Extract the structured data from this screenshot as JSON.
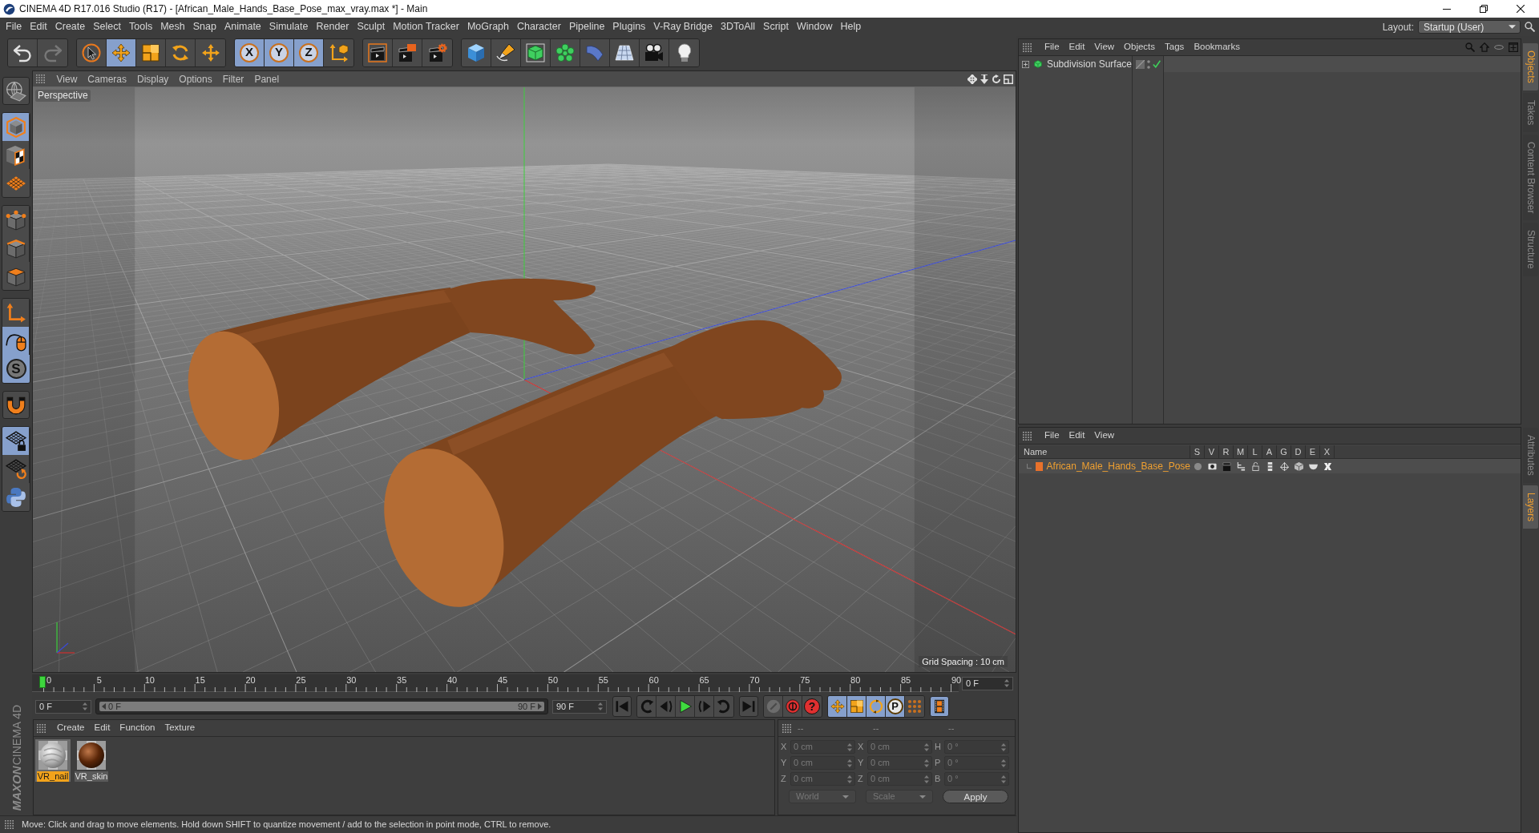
{
  "window": {
    "title": "CINEMA 4D R17.016 Studio (R17) - [African_Male_Hands_Base_Pose_max_vray.max *] - Main"
  },
  "menu_bar": {
    "items": [
      "File",
      "Edit",
      "Create",
      "Select",
      "Tools",
      "Mesh",
      "Snap",
      "Animate",
      "Simulate",
      "Render",
      "Sculpt",
      "Motion Tracker",
      "MoGraph",
      "Character",
      "Pipeline",
      "Plugins",
      "V-Ray Bridge",
      "3DToAll",
      "Script",
      "Window",
      "Help"
    ],
    "layout_label": "Layout:",
    "layout_value": "Startup (User)"
  },
  "toolbar": {
    "groups": [
      {
        "items": [
          {
            "kind": "undo",
            "selected": false,
            "disabled": false
          },
          {
            "kind": "redo",
            "selected": false,
            "disabled": true
          }
        ]
      },
      {
        "items": [
          {
            "kind": "live-selection",
            "selected": false,
            "disabled": false
          },
          {
            "kind": "move",
            "selected": true,
            "disabled": false
          },
          {
            "kind": "scale",
            "selected": false,
            "disabled": false
          },
          {
            "kind": "rotate",
            "selected": false,
            "disabled": false
          },
          {
            "kind": "cross-move",
            "selected": false,
            "disabled": false
          }
        ]
      },
      {
        "items": [
          {
            "kind": "axis",
            "label": "X",
            "selected": true,
            "disabled": false
          },
          {
            "kind": "axis",
            "label": "Y",
            "selected": true,
            "disabled": false
          },
          {
            "kind": "axis",
            "label": "Z",
            "selected": true,
            "disabled": false
          },
          {
            "kind": "coordinate-system",
            "selected": false,
            "disabled": false
          }
        ]
      },
      {
        "items": [
          {
            "kind": "render-view",
            "selected": false,
            "disabled": false
          },
          {
            "kind": "render-picture",
            "selected": false,
            "disabled": false
          },
          {
            "kind": "render-settings",
            "selected": false,
            "disabled": false
          }
        ]
      },
      {
        "items": [
          {
            "kind": "cube",
            "selected": false,
            "disabled": false
          },
          {
            "kind": "pen",
            "selected": false,
            "disabled": false
          },
          {
            "kind": "subdivision",
            "selected": false,
            "disabled": false
          },
          {
            "kind": "cloner",
            "selected": false,
            "disabled": false
          },
          {
            "kind": "bend",
            "selected": false,
            "disabled": false
          },
          {
            "kind": "floor",
            "selected": false,
            "disabled": false
          },
          {
            "kind": "camera",
            "selected": false,
            "disabled": false
          },
          {
            "kind": "light",
            "selected": false,
            "disabled": false
          }
        ]
      }
    ]
  },
  "mode_toolbar": {
    "groups": [
      {
        "items": [
          {
            "kind": "make-editable",
            "selected": false
          }
        ]
      },
      {
        "items": [
          {
            "kind": "model",
            "selected": true
          },
          {
            "kind": "texture",
            "selected": false
          },
          {
            "kind": "workplane",
            "selected": false
          }
        ]
      },
      {
        "items": [
          {
            "kind": "points",
            "selected": false
          },
          {
            "kind": "edges",
            "selected": false
          },
          {
            "kind": "polygons",
            "selected": false
          }
        ]
      },
      {
        "items": [
          {
            "kind": "axis-mode",
            "selected": false
          },
          {
            "kind": "tweak",
            "selected": true
          },
          {
            "kind": "solo",
            "label": "S",
            "selected": true
          }
        ]
      },
      {
        "items": [
          {
            "kind": "snap",
            "selected": false
          }
        ]
      },
      {
        "items": [
          {
            "kind": "grid-lock",
            "selected": true
          },
          {
            "kind": "grid-rotate",
            "selected": false
          },
          {
            "kind": "python",
            "selected": false
          }
        ]
      }
    ]
  },
  "logo": {
    "brand": "MAXON",
    "product": "CINEMA 4D"
  },
  "viewport": {
    "menu": [
      "View",
      "Cameras",
      "Display",
      "Options",
      "Filter",
      "Panel"
    ],
    "camera": "Perspective",
    "grid_spacing": "Grid Spacing : 10 cm"
  },
  "timeline": {
    "ticks": [
      "0",
      "5",
      "10",
      "15",
      "20",
      "25",
      "30",
      "35",
      "40",
      "45",
      "50",
      "55",
      "60",
      "65",
      "70",
      "75",
      "80",
      "85",
      "90"
    ],
    "level": 0,
    "frame_field": "0 F"
  },
  "transport": {
    "start_field": "0 F",
    "range": {
      "start": "0 F",
      "end": "90 F",
      "level": 1
    },
    "end_field": "90 F",
    "groups": [
      {
        "items": [
          {
            "kind": "go-start",
            "selected": false
          }
        ]
      },
      {
        "items": [
          {
            "kind": "prev-key",
            "selected": false
          },
          {
            "kind": "step-back",
            "selected": false
          },
          {
            "kind": "play",
            "selected": false
          },
          {
            "kind": "step-forward",
            "selected": false
          },
          {
            "kind": "next-key",
            "selected": false
          }
        ]
      },
      {
        "items": [
          {
            "kind": "go-end",
            "selected": false
          }
        ]
      },
      {
        "items": [
          {
            "kind": "autokey",
            "selected": false
          },
          {
            "kind": "record",
            "selected": false
          },
          {
            "kind": "record-help",
            "label": "?",
            "selected": false
          }
        ]
      },
      {
        "items": [
          {
            "kind": "key-position",
            "selected": true
          },
          {
            "kind": "key-scale",
            "selected": true
          },
          {
            "kind": "key-rotation",
            "selected": true
          },
          {
            "kind": "key-parameter",
            "label": "P",
            "selected": true
          },
          {
            "kind": "key-point",
            "selected": false
          }
        ]
      },
      {
        "items": [
          {
            "kind": "timeline-view",
            "selected": true
          }
        ]
      }
    ]
  },
  "materials": {
    "menu": [
      "Create",
      "Edit",
      "Function",
      "Texture"
    ],
    "items": [
      {
        "name": "VR_nail",
        "kind": "nail",
        "selected": true
      },
      {
        "name": "VR_skin",
        "kind": "skin",
        "selected": false
      }
    ]
  },
  "coordinates": {
    "columns": [
      {
        "header": "--",
        "fields": [
          {
            "axis": "X",
            "value": "0 cm"
          },
          {
            "axis": "Y",
            "value": "0 cm"
          },
          {
            "axis": "Z",
            "value": "0 cm"
          }
        ]
      },
      {
        "header": "--",
        "fields": [
          {
            "axis": "X",
            "value": "0 cm"
          },
          {
            "axis": "Y",
            "value": "0 cm"
          },
          {
            "axis": "Z",
            "value": "0 cm"
          }
        ]
      },
      {
        "header": "--",
        "fields": [
          {
            "axis": "H",
            "value": "0 °"
          },
          {
            "axis": "P",
            "value": "0 °"
          },
          {
            "axis": "B",
            "value": "0 °"
          }
        ]
      }
    ],
    "dropdowns": [
      "World",
      "Scale"
    ],
    "apply": "Apply"
  },
  "status_bar": "Move: Click and drag to move elements. Hold down SHIFT to quantize movement / add to the selection in point mode, CTRL to remove.",
  "object_manager": {
    "menu": [
      "File",
      "Edit",
      "View",
      "Objects",
      "Tags",
      "Bookmarks"
    ],
    "objects": [
      {
        "name": "Subdivision Surface",
        "expanded": false,
        "enabled": true
      }
    ]
  },
  "layer_manager": {
    "menu": [
      "File",
      "Edit",
      "View"
    ],
    "columns": [
      "Name",
      "S",
      "V",
      "R",
      "M",
      "L",
      "A",
      "G",
      "D",
      "E",
      "X"
    ],
    "layers": [
      {
        "name": "African_Male_Hands_Base_Pose",
        "color": "#e8712b"
      }
    ]
  },
  "side_tabs": {
    "top": [
      {
        "label": "Objects",
        "selected": true
      },
      {
        "label": "Takes",
        "selected": false
      },
      {
        "label": "Content Browser",
        "selected": false
      },
      {
        "label": "Structure",
        "selected": false
      }
    ],
    "bottom": [
      {
        "label": "Attributes",
        "selected": false
      },
      {
        "label": "Layers",
        "selected": true
      }
    ]
  }
}
